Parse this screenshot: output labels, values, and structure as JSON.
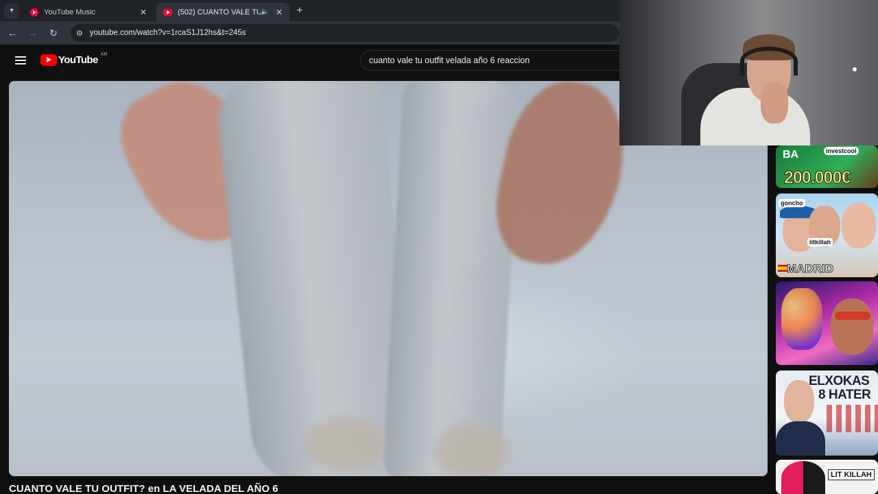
{
  "browser": {
    "tabs": [
      {
        "title": "YouTube Music",
        "active": false
      },
      {
        "title": "(502) CUANTO VALE TU OU",
        "active": true
      }
    ],
    "address": "youtube.com/watch?v=1rcaS1J12hs&t=245s",
    "icons": [
      "tab-search-icon",
      "back-icon",
      "forward-icon",
      "reload-icon",
      "site-info-icon",
      "speaker-icon",
      "close-icon",
      "new-tab-icon"
    ]
  },
  "youtube": {
    "logo_text": "YouTube",
    "country_code": "AR",
    "search_query": "cuanto vale tu outfit velada año 6 reaccion",
    "video_title": "CUANTO VALE TU OUTFIT? en LA VELADA DEL AÑO 6"
  },
  "recommendations": [
    {
      "texts": [
        "BA",
        "200.000€"
      ],
      "tag": "investcool"
    },
    {
      "texts": [
        "MADRID"
      ],
      "tags": [
        "goncho",
        "litkillah"
      ]
    },
    {
      "texts": []
    },
    {
      "texts": [
        "ELXOKAS",
        "8 HATER"
      ]
    },
    {
      "texts": [
        "LIT KILLAH"
      ]
    }
  ],
  "colors": {
    "youtube_red": "#ff0000",
    "page_bg": "#0f0f0f",
    "tab_bg": "#1f2328",
    "toolbar_bg": "#2f353c"
  }
}
